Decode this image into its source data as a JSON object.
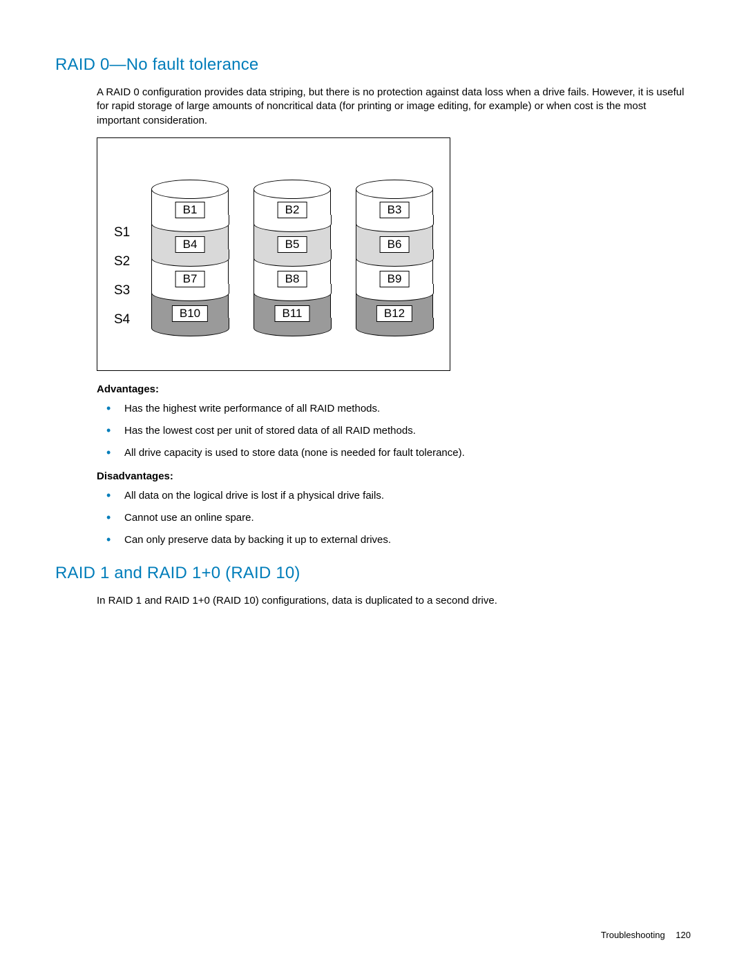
{
  "section1": {
    "heading": "RAID 0—No fault tolerance",
    "intro": "A RAID 0 configuration provides data striping, but there is no protection against data loss when a drive fails. However, it is useful for rapid storage of large amounts of noncritical data (for printing or image editing, for example) or when cost is the most important consideration.",
    "advantages_label": "Advantages:",
    "advantages": [
      "Has the highest write performance of all RAID methods.",
      "Has the lowest cost per unit of stored data of all RAID methods.",
      "All drive capacity is used to store data (none is needed for fault tolerance)."
    ],
    "disadvantages_label": "Disadvantages:",
    "disadvantages": [
      "All data on the logical drive is lost if a physical drive fails.",
      "Cannot use an online spare.",
      "Can only preserve data by backing it up to external drives."
    ]
  },
  "diagram": {
    "stripes": [
      "S1",
      "S2",
      "S3",
      "S4"
    ],
    "drives": [
      {
        "blocks": [
          "B1",
          "B4",
          "B7",
          "B10"
        ]
      },
      {
        "blocks": [
          "B2",
          "B5",
          "B8",
          "B11"
        ]
      },
      {
        "blocks": [
          "B3",
          "B6",
          "B9",
          "B12"
        ]
      }
    ]
  },
  "section2": {
    "heading": "RAID 1 and RAID 1+0 (RAID 10)",
    "intro": "In RAID 1 and RAID 1+0 (RAID 10) configurations, data is duplicated to a second drive."
  },
  "footer": {
    "section": "Troubleshooting",
    "page": "120"
  }
}
